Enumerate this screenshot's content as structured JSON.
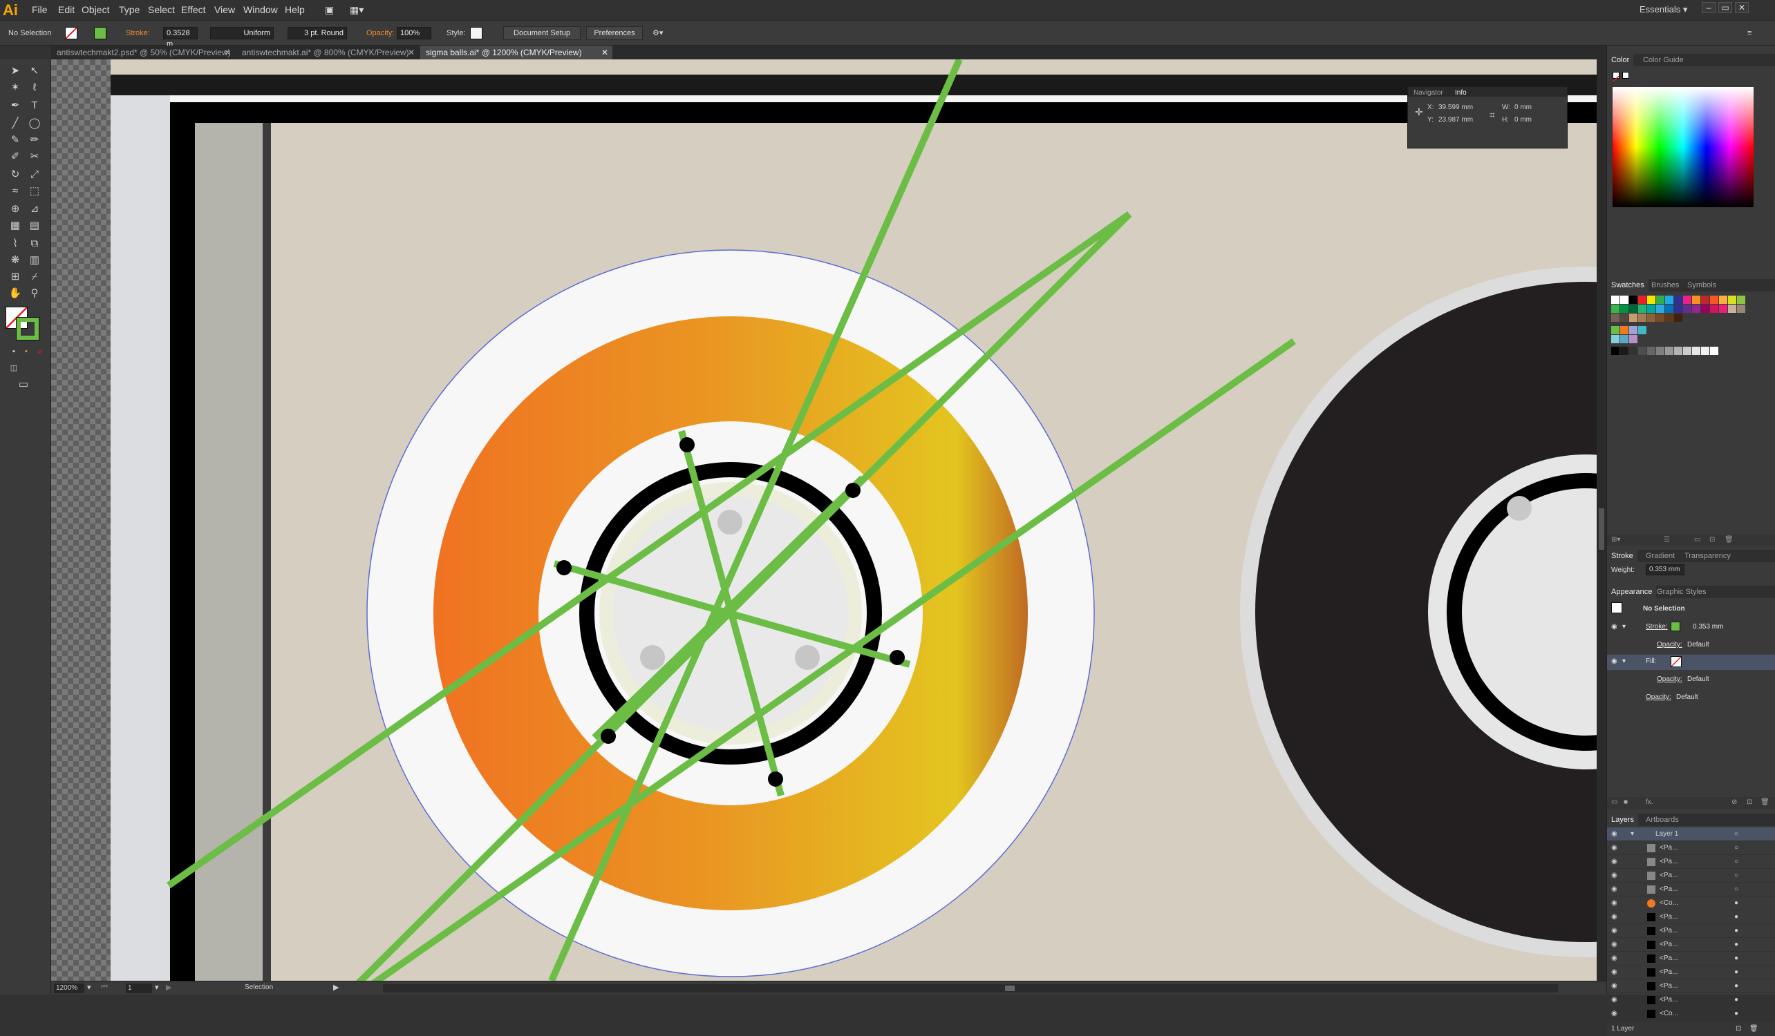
{
  "app": {
    "logo": "Ai"
  },
  "menu": [
    "File",
    "Edit",
    "Object",
    "Type",
    "Select",
    "Effect",
    "View",
    "Window",
    "Help"
  ],
  "workspace": {
    "label": "Essentials",
    "arrow": "▾"
  },
  "window_controls": [
    "–",
    "▭",
    "✕"
  ],
  "control_bar": {
    "selection": "No Selection",
    "stroke_label": "Stroke:",
    "stroke_weight": "0.3528 m",
    "profile": "Uniform",
    "brush": "3 pt. Round",
    "opacity_label": "Opacity:",
    "opacity": "100%",
    "style_label": "Style:",
    "document_setup": "Document Setup",
    "preferences": "Preferences"
  },
  "tabs": [
    {
      "label": "antiswtechmakt2.psd* @ 50% (CMYK/Preview)",
      "active": false
    },
    {
      "label": "antiswtechmakt.ai* @ 800% (CMYK/Preview)",
      "active": false
    },
    {
      "label": "sigma balls.ai* @ 1200% (CMYK/Preview)",
      "active": true
    }
  ],
  "tab_close": "✕",
  "info_panel": {
    "tabs": [
      "Navigator",
      "Info"
    ],
    "x_label": "X:",
    "x": "39.599 mm",
    "y_label": "Y:",
    "y": "23.987 mm",
    "w_label": "W:",
    "w": "0 mm",
    "h_label": "H:",
    "h": "0 mm"
  },
  "color_panel": {
    "tabs": [
      "Color",
      "Color Guide"
    ]
  },
  "swatches_panel": {
    "tabs": [
      "Swatches",
      "Brushes",
      "Symbols"
    ]
  },
  "stroke_panel": {
    "tabs": [
      "Stroke",
      "Gradient",
      "Transparency"
    ],
    "weight_label": "Weight:",
    "weight": "0.353 mm"
  },
  "appearance_panel": {
    "tabs": [
      "Appearance",
      "Graphic Styles"
    ],
    "title": "No Selection",
    "stroke_label": "Stroke:",
    "stroke_value": "0.353 mm",
    "opacity_label": "Opacity:",
    "opacity_value": "Default",
    "fill_label": "Fill:",
    "fx": "fx."
  },
  "layers_panel": {
    "tabs": [
      "Layers",
      "Artboards"
    ],
    "layer": "Layer 1",
    "items": [
      "<Pa...",
      "<Pa...",
      "<Pa...",
      "<Pa...",
      "<Co...",
      "<Pa...",
      "<Pa...",
      "<Pa...",
      "<Pa...",
      "<Pa...",
      "<Pa...",
      "<Pa...",
      "<Co..."
    ],
    "footer": "1 Layer"
  },
  "status_bar": {
    "zoom": "1200%",
    "artboard": "1",
    "tool": "Selection"
  },
  "colors": {
    "bg_canvas": "#d6cfc1",
    "accent_green": "#6cbd45",
    "ring_orange": "#f07a22",
    "ring_yellow": "#e3c520",
    "dark": "#222222"
  }
}
